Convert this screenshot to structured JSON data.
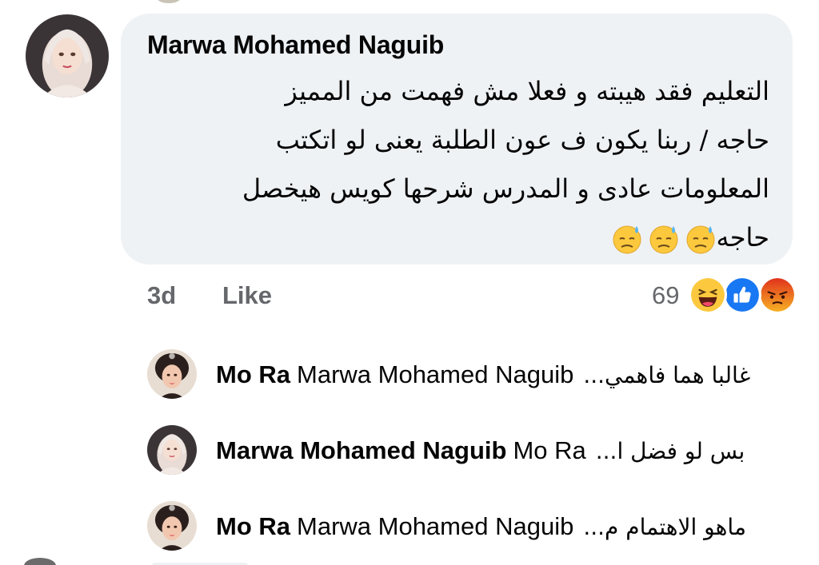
{
  "comment": {
    "author": "Marwa Mohamed Naguib",
    "text": "التعليم فقد هيبته و فعلا مش فهمت من المميز\nحاجه / ربنا يكون ف عون الطلبة يعنى لو اتكتب\nالمعلومات عادى و المدرس شرحها كويس هيخصل\nحاجه",
    "emoji_names": [
      "downcast-face-with-sweat-icon",
      "downcast-face-with-sweat-icon",
      "downcast-face-with-sweat-icon"
    ],
    "time": "3d",
    "like_label": "Like",
    "reaction_count": "69",
    "reaction_icons": [
      "haha-icon",
      "like-icon",
      "angry-icon"
    ]
  },
  "replies": [
    {
      "name": "Mo Ra",
      "tag": "Marwa Mohamed Naguib",
      "snippet": "غالبا هما فاهمي..."
    },
    {
      "name": "Marwa Mohamed Naguib",
      "tag": "Mo Ra",
      "snippet": "بس لو فضل ا..."
    },
    {
      "name": "Mo Ra",
      "tag": "Marwa Mohamed Naguib",
      "snippet": "ماهو الاهتمام م..."
    }
  ],
  "colors": {
    "bubble": "#eff2f5",
    "meta_text": "#65676b",
    "like_blue": "#1877f2",
    "haha_yellow": "#fcc93e",
    "angry_red": "#e9710f"
  }
}
